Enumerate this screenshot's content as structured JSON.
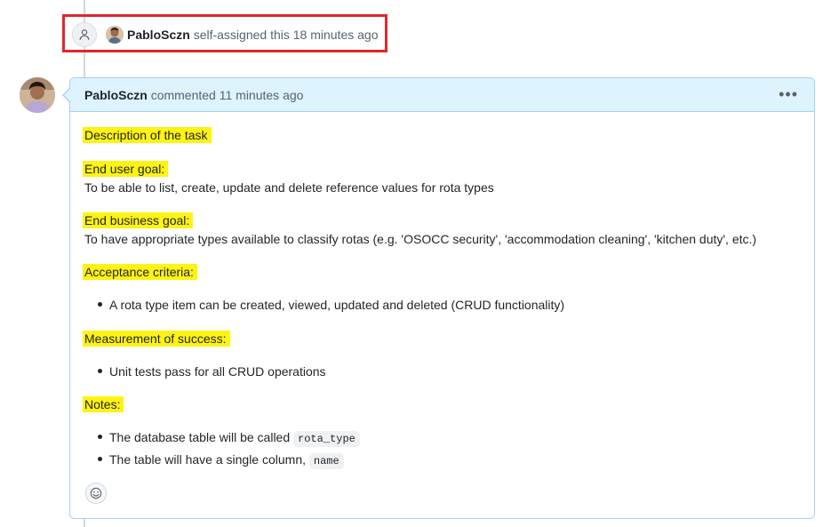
{
  "event": {
    "actor": "PabloSczn",
    "action": "self-assigned this",
    "time": "18 minutes ago",
    "icon": "person-icon"
  },
  "comment": {
    "author": "PabloSczn",
    "action": "commented",
    "time": "11 minutes ago",
    "menu_icon": "kebab-menu-icon",
    "sections": {
      "description_heading": "Description of the task",
      "end_user_heading": "End user goal:",
      "end_user_text": "To be able to list, create, update and delete reference values for rota types",
      "end_business_heading": "End business goal:",
      "end_business_text": "To have appropriate types available to classify rotas (e.g. 'OSOCC security', 'accommodation cleaning', 'kitchen duty', etc.)",
      "acceptance_heading": "Acceptance criteria:",
      "acceptance_item": "A rota type item can be created, viewed, updated and deleted (CRUD functionality)",
      "measurement_heading": "Measurement of success:",
      "measurement_item": "Unit tests pass for all CRUD operations",
      "notes_heading": "Notes:",
      "notes_item1_prefix": "The database table will be called",
      "notes_item1_code": "rota_type",
      "notes_item2_prefix": "The table will have a single column,",
      "notes_item2_code": "name"
    },
    "reaction_icon": "smiley-icon"
  },
  "colors": {
    "highlight": "#fff314",
    "header_bg": "#ddf4ff",
    "border": "#a8d1f3",
    "annotation_box": "#e3262b"
  }
}
